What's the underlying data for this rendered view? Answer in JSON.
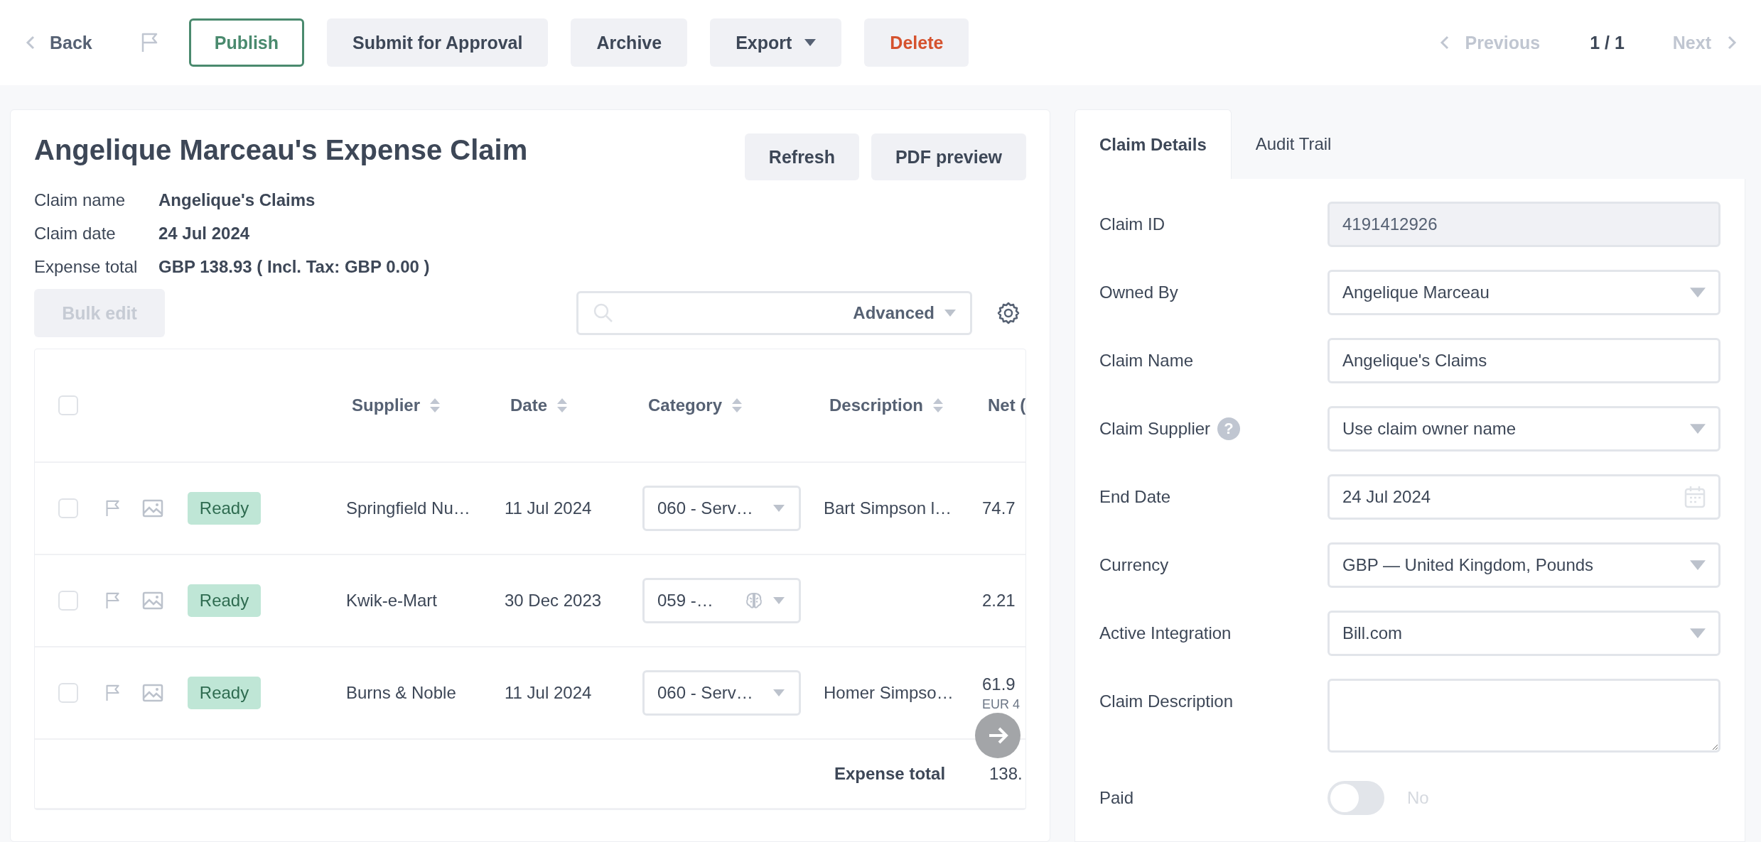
{
  "toolbar": {
    "back": "Back",
    "buttons": [
      {
        "label": "Publish",
        "kind": "outline"
      },
      {
        "label": "Submit for Approval",
        "kind": "plain"
      },
      {
        "label": "Archive",
        "kind": "plain"
      },
      {
        "label": "Export",
        "kind": "dropdown"
      },
      {
        "label": "Delete",
        "kind": "danger"
      }
    ],
    "pager": {
      "previous": "Previous",
      "previous_disabled": true,
      "page": "1 / 1",
      "next": "Next",
      "next_disabled": true
    }
  },
  "claim": {
    "title": "Angelique Marceau's Expense Claim",
    "actions": [
      "Refresh",
      "PDF preview"
    ],
    "summary": [
      {
        "label": "Claim name",
        "value": "Angelique's Claims"
      },
      {
        "label": "Claim date",
        "value": "24 Jul 2024"
      },
      {
        "label": "Expense total",
        "value": "GBP 138.93 ( Incl. Tax: GBP 0.00 )"
      }
    ],
    "bulk_edit": {
      "label": "Bulk edit",
      "disabled": true
    },
    "search": {
      "advanced": "Advanced"
    },
    "table": {
      "select_all_checked": false,
      "columns": [
        "Supplier",
        "Date",
        "Category",
        "Description",
        "Net ("
      ],
      "rows": [
        {
          "checked": false,
          "status": "Ready",
          "supplier": "Springfield Nu…",
          "date": "11 Jul 2024",
          "category": "060 - Serv…",
          "auto_categorized": false,
          "description": "Bart Simpson l…",
          "net": "74.7"
        },
        {
          "checked": false,
          "status": "Ready",
          "supplier": "Kwik-e-Mart",
          "date": "30 Dec 2023",
          "category": "059 -…",
          "auto_categorized": true,
          "net": "2.21"
        },
        {
          "checked": false,
          "status": "Ready",
          "supplier": "Burns & Noble",
          "date": "11 Jul 2024",
          "category": "060 - Serv…",
          "auto_categorized": false,
          "description": "Homer Simpso…",
          "net": "61.9",
          "net_sub": "EUR 4"
        }
      ],
      "footer": {
        "label": "Expense total",
        "value": "138."
      }
    }
  },
  "details": {
    "tabs": [
      {
        "label": "Claim Details",
        "selected": true
      },
      {
        "label": "Audit Trail",
        "selected": false
      }
    ],
    "fields": [
      {
        "label": "Claim ID",
        "kind": "readonly",
        "value": "4191412926"
      },
      {
        "label": "Owned By",
        "kind": "select",
        "value": "Angelique Marceau"
      },
      {
        "label": "Claim Name",
        "kind": "text",
        "value": "Angelique's Claims"
      },
      {
        "label": "Claim Supplier",
        "kind": "select",
        "value": "Use claim owner name",
        "help": "?"
      },
      {
        "label": "End Date",
        "kind": "date",
        "value": "24 Jul 2024"
      },
      {
        "label": "Currency",
        "kind": "select",
        "value": "GBP — United Kingdom, Pounds"
      },
      {
        "label": "Active Integration",
        "kind": "select",
        "value": "Bill.com"
      },
      {
        "label": "Claim Description",
        "kind": "textarea"
      },
      {
        "label": "Paid",
        "kind": "toggle",
        "on": false,
        "value": "No"
      }
    ]
  }
}
